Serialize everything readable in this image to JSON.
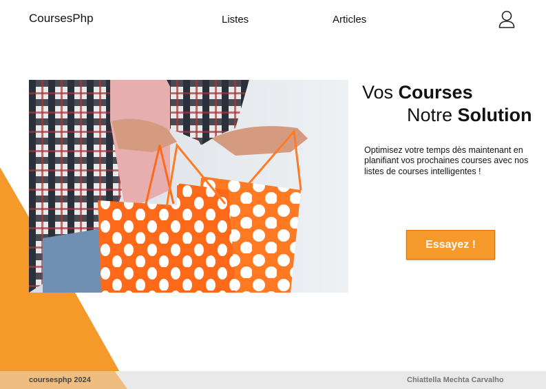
{
  "header": {
    "brand": "CoursesPhp",
    "nav": [
      {
        "label": "Listes"
      },
      {
        "label": "Articles"
      }
    ],
    "user_icon": "user-icon"
  },
  "hero": {
    "image_alt": "shopping-bags-photo",
    "headline_line1_prefix": "Vos ",
    "headline_line1_bold": "Courses",
    "headline_line2_prefix": "Notre ",
    "headline_line2_bold": "Solution",
    "description": "Optimisez votre temps dès maintenant en planifiant vos prochaines courses avec nos listes de courses intelligentes !",
    "cta_label": "Essayez !"
  },
  "footer": {
    "left": "coursesphp 2024",
    "right": "Chiattella Mechta Carvalho"
  },
  "colors": {
    "accent": "#f6992b",
    "footer_bg": "#e9e9e9"
  }
}
